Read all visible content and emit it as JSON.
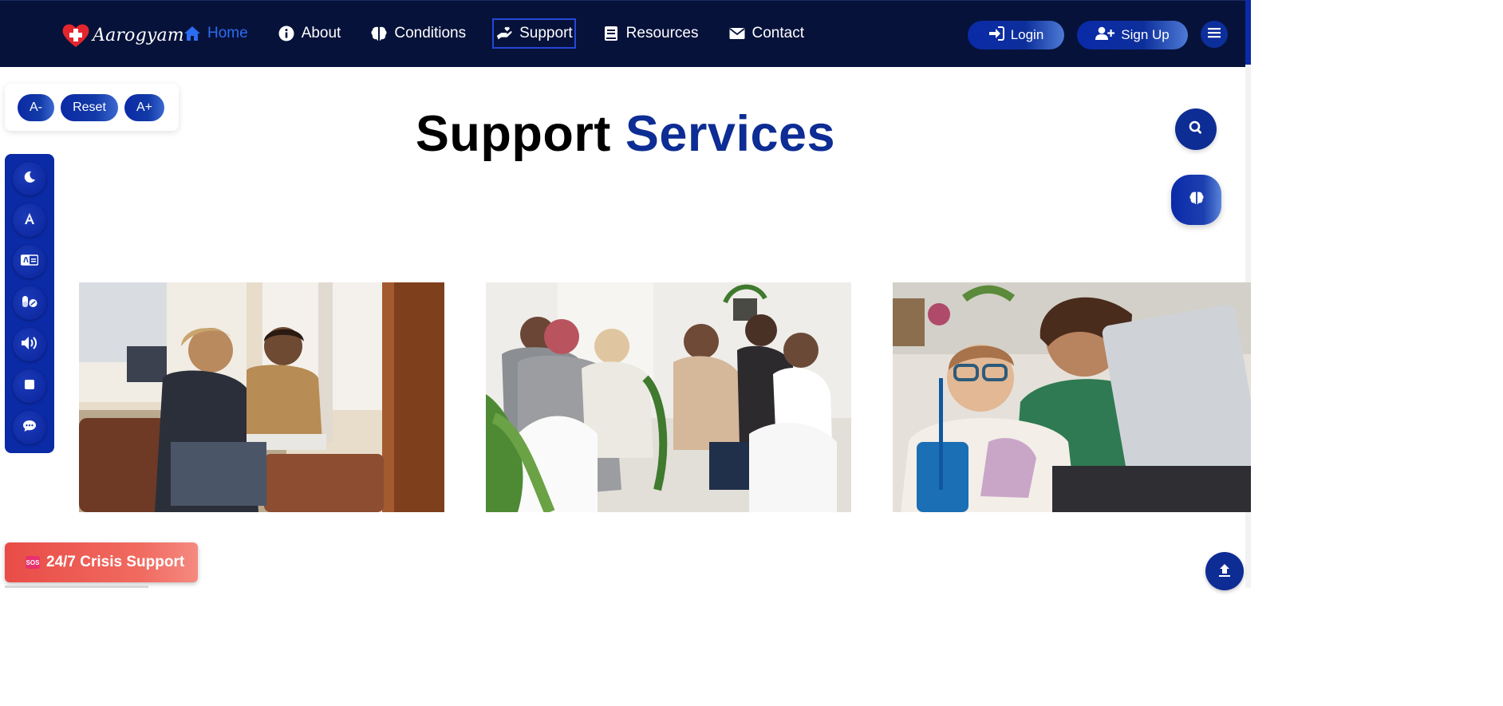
{
  "brand": {
    "name": "Aarogyam",
    "logo_icon": "heart-cross-icon",
    "logo_color": "#e3262e"
  },
  "nav": {
    "links": [
      {
        "label": "Home",
        "icon": "home-icon",
        "active": true
      },
      {
        "label": "About",
        "icon": "info-circle-icon"
      },
      {
        "label": "Conditions",
        "icon": "brain-icon"
      },
      {
        "label": "Support",
        "icon": "hand-holding-heart-icon",
        "focused": true
      },
      {
        "label": "Resources",
        "icon": "book-icon"
      },
      {
        "label": "Contact",
        "icon": "envelope-icon"
      }
    ],
    "login_label": "Login",
    "signup_label": "Sign Up",
    "menu_icon": "hamburger-icon"
  },
  "font_controls": {
    "decrease": "A-",
    "reset": "Reset",
    "increase": "A+"
  },
  "a11y_tools": [
    "moon-icon",
    "font-icon",
    "language-card-icon",
    "pills-icon",
    "volume-icon",
    "stop-icon",
    "comment-icon"
  ],
  "heading": {
    "part1": "Support",
    "part2": "Services"
  },
  "floating": {
    "search_icon": "search-icon",
    "brain_icon": "brain-icon"
  },
  "crisis": {
    "badge": "SOS",
    "label": "24/7 Crisis Support"
  },
  "scroll_top_icon": "arrow-up-icon",
  "colors": {
    "nav_bg": "#06123a",
    "accent": "#0d2c94",
    "active_link": "#2c6cf0",
    "crisis": "#e94c47"
  }
}
